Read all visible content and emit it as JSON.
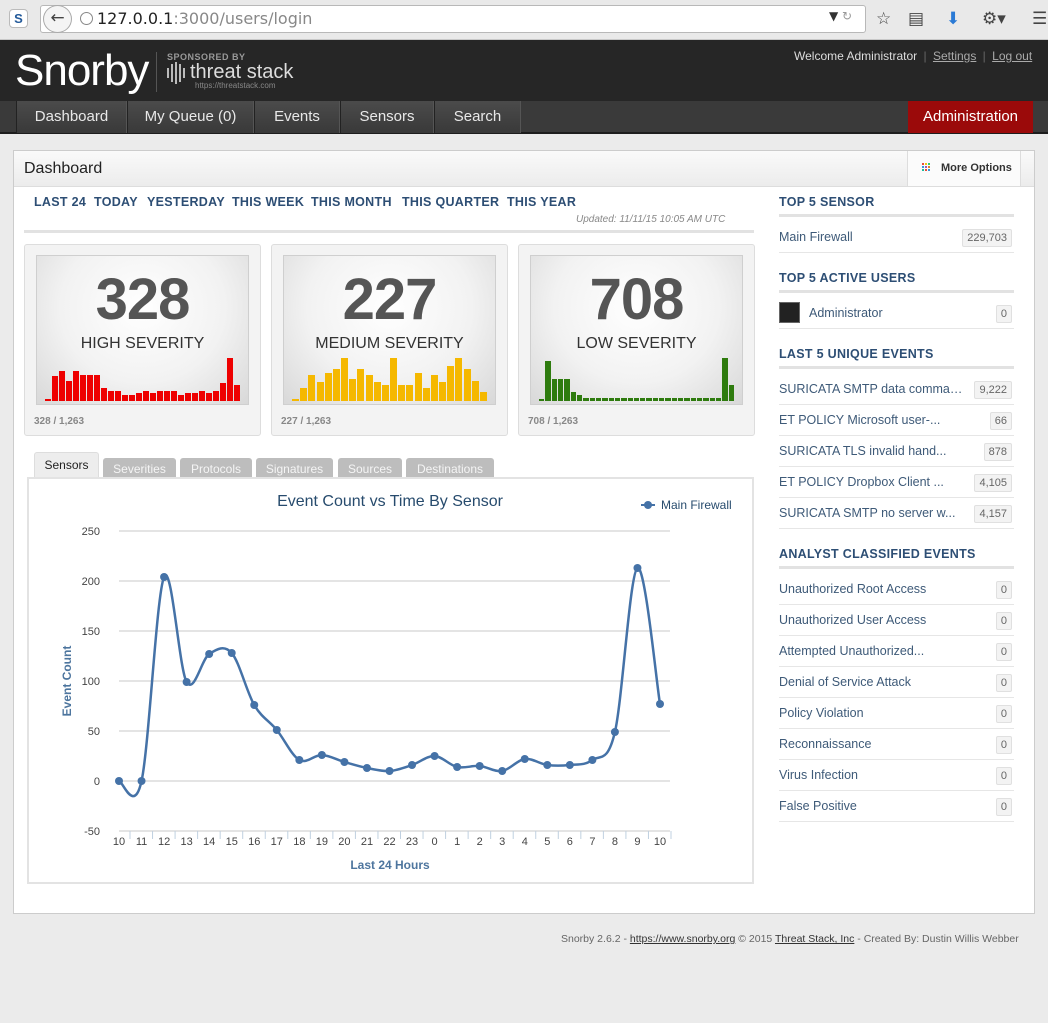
{
  "browser": {
    "favicon_letter": "S",
    "url_host": "127.0.0.1",
    "url_rest": ":3000/users/login",
    "icons": [
      "back-icon",
      "globe-icon",
      "dropdown-icon",
      "reload-icon",
      "star-icon",
      "reader-icon",
      "download-icon",
      "extension-icon",
      "menu-icon"
    ]
  },
  "header": {
    "logo": "Snorby",
    "sponsored_by": "SPONSORED BY",
    "sponsor_name": "threat stack",
    "sponsor_url": "https://threatstack.com",
    "welcome": "Welcome Administrator",
    "settings": "Settings",
    "logout": "Log out",
    "separator": "|"
  },
  "nav": {
    "items": [
      "Dashboard",
      "My Queue (0)",
      "Events",
      "Sensors",
      "Search"
    ],
    "admin": "Administration",
    "admin_color": "#9b0a0a"
  },
  "dashboard": {
    "title": "Dashboard",
    "more_options": "More Options",
    "time_tabs": [
      "LAST 24",
      "TODAY",
      "YESTERDAY",
      "THIS WEEK",
      "THIS MONTH",
      "THIS QUARTER",
      "THIS YEAR"
    ],
    "updated": "Updated: 11/11/15 10:05 AM UTC"
  },
  "severities": [
    {
      "count": "328",
      "label": "HIGH SEVERITY",
      "footer": "328 / 1,263",
      "color": "#ee0000",
      "bars": [
        0.05,
        0.55,
        0.66,
        0.44,
        0.66,
        0.58,
        0.58,
        0.58,
        0.3,
        0.22,
        0.22,
        0.13,
        0.13,
        0.17,
        0.22,
        0.17,
        0.22,
        0.22,
        0.22,
        0.13,
        0.17,
        0.17,
        0.22,
        0.17,
        0.22,
        0.39,
        0.95,
        0.36
      ]
    },
    {
      "count": "227",
      "label": "MEDIUM SEVERITY",
      "footer": "227 / 1,263",
      "color": "#f5b800",
      "bars": [
        0.04,
        0.28,
        0.58,
        0.42,
        0.62,
        0.72,
        0.95,
        0.5,
        0.72,
        0.58,
        0.42,
        0.35,
        0.95,
        0.35,
        0.35,
        0.62,
        0.28,
        0.58,
        0.42,
        0.78,
        0.95,
        0.72,
        0.45,
        0.2
      ]
    },
    {
      "count": "708",
      "label": "LOW SEVERITY",
      "footer": "708 / 1,263",
      "color": "#2e7b0e",
      "bars": [
        0.05,
        0.9,
        0.5,
        0.5,
        0.5,
        0.2,
        0.13,
        0.06,
        0.06,
        0.06,
        0.06,
        0.06,
        0.06,
        0.06,
        0.06,
        0.06,
        0.06,
        0.06,
        0.06,
        0.06,
        0.06,
        0.06,
        0.06,
        0.06,
        0.06,
        0.06,
        0.06,
        0.06,
        0.06,
        0.95,
        0.35
      ]
    }
  ],
  "chart_tabs": {
    "active": "Sensors",
    "inactive": [
      "Severities",
      "Protocols",
      "Signatures",
      "Sources",
      "Destinations"
    ]
  },
  "chart_data": {
    "type": "line",
    "title": "Event Count vs Time By Sensor",
    "xlabel": "Last 24 Hours",
    "ylabel": "Event Count",
    "categories": [
      "10",
      "11",
      "12",
      "13",
      "14",
      "15",
      "16",
      "17",
      "18",
      "19",
      "20",
      "21",
      "22",
      "23",
      "0",
      "1",
      "2",
      "3",
      "4",
      "5",
      "6",
      "7",
      "8",
      "9",
      "10"
    ],
    "series": [
      {
        "name": "Main Firewall",
        "color": "#4572a7",
        "values": [
          0,
          0,
          204,
          99,
          127,
          128,
          76,
          51,
          21,
          26,
          19,
          13,
          10,
          16,
          25,
          14,
          15,
          10,
          22,
          16,
          16,
          21,
          49,
          213,
          77
        ]
      }
    ],
    "ylim": [
      -50,
      250
    ],
    "yticks": [
      -50,
      0,
      50,
      100,
      150,
      200,
      250
    ],
    "legend_position": "top-right",
    "grid": true
  },
  "sidebar": {
    "top_sensor": {
      "heading": "TOP 5 SENSOR",
      "rows": [
        {
          "label": "Main Firewall",
          "count": "229,703"
        }
      ]
    },
    "active_users": {
      "heading": "TOP 5 ACTIVE USERS",
      "rows": [
        {
          "label": "Administrator",
          "count": "0"
        }
      ]
    },
    "unique_events": {
      "heading": "LAST 5 UNIQUE EVENTS",
      "rows": [
        {
          "label": "SURICATA SMTP data comman...",
          "count": "9,222"
        },
        {
          "label": "ET POLICY Microsoft user-...",
          "count": "66"
        },
        {
          "label": "SURICATA TLS invalid hand...",
          "count": "878"
        },
        {
          "label": "ET POLICY Dropbox Client ...",
          "count": "4,105"
        },
        {
          "label": "SURICATA SMTP no server w...",
          "count": "4,157"
        }
      ]
    },
    "classified": {
      "heading": "ANALYST CLASSIFIED EVENTS",
      "rows": [
        {
          "label": "Unauthorized Root Access",
          "count": "0"
        },
        {
          "label": "Unauthorized User Access",
          "count": "0"
        },
        {
          "label": "Attempted Unauthorized...",
          "count": "0"
        },
        {
          "label": "Denial of Service Attack",
          "count": "0"
        },
        {
          "label": "Policy Violation",
          "count": "0"
        },
        {
          "label": "Reconnaissance",
          "count": "0"
        },
        {
          "label": "Virus Infection",
          "count": "0"
        },
        {
          "label": "False Positive",
          "count": "0"
        }
      ]
    }
  },
  "footer": {
    "version": "Snorby 2.6.2 - ",
    "site": "https://www.snorby.org",
    "copyright": " © 2015 ",
    "company": "Threat Stack, Inc",
    "credits": " - Created By: Dustin Willis Webber"
  }
}
